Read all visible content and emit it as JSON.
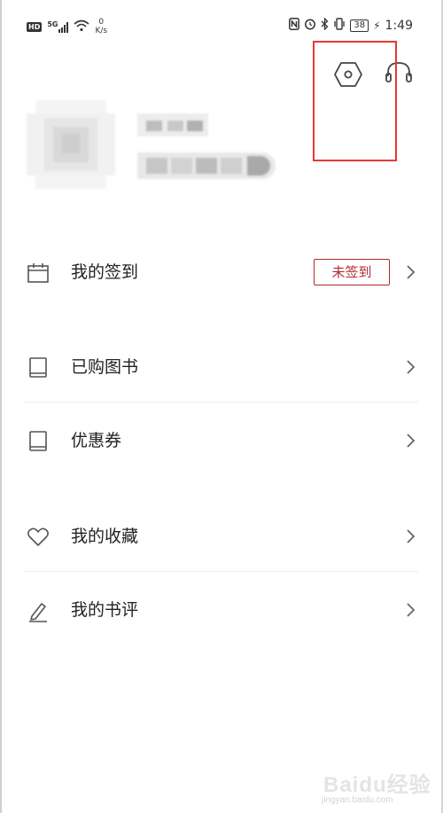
{
  "status_bar": {
    "hd": "HD",
    "signal_label": "5G",
    "net_speed_value": "0",
    "net_speed_unit": "K/s",
    "battery": "38",
    "time": "1:49"
  },
  "menu": {
    "checkin": {
      "label": "我的签到",
      "status_badge": "未签到",
      "icon": "calendar-icon"
    },
    "purchased_books": {
      "label": "已购图书",
      "icon": "book-icon"
    },
    "coupons": {
      "label": "优惠券",
      "icon": "book-icon"
    },
    "favorites": {
      "label": "我的收藏",
      "icon": "heart-icon"
    },
    "book_reviews": {
      "label": "我的书评",
      "icon": "pen-icon"
    }
  },
  "colors": {
    "accent": "#b22a2a",
    "highlight": "#e53935",
    "divider": "#ececec"
  },
  "watermark": {
    "main": "Baidu经验",
    "sub": "jingyan.baidu.com"
  }
}
